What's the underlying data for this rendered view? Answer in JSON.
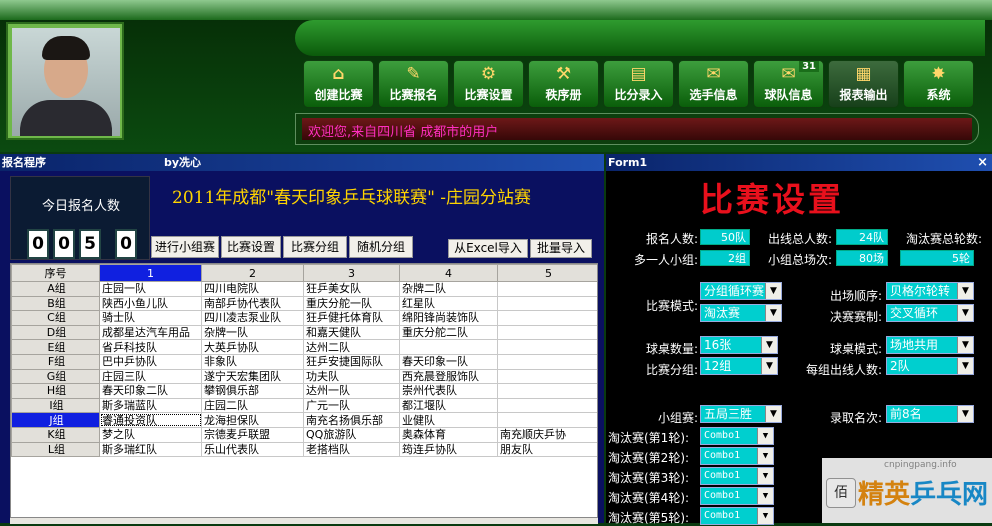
{
  "nav": {
    "buttons": [
      {
        "label": "创建比赛",
        "icon": "house-icon",
        "glyph": "⌂"
      },
      {
        "label": "比赛报名",
        "icon": "notebook-icon",
        "glyph": "✎"
      },
      {
        "label": "比赛设置",
        "icon": "tools-icon",
        "glyph": "⚙"
      },
      {
        "label": "秩序册",
        "icon": "gavel-icon",
        "glyph": "⚒"
      },
      {
        "label": "比分录入",
        "icon": "folder-icon",
        "glyph": "▤"
      },
      {
        "label": "选手信息",
        "icon": "scroll-icon",
        "glyph": "✉"
      },
      {
        "label": "球队信息",
        "icon": "envelope-icon",
        "glyph": "✉",
        "badge": "31"
      },
      {
        "label": "报表输出",
        "icon": "chest-icon",
        "glyph": "▦"
      },
      {
        "label": "系统",
        "icon": "gear-icon",
        "glyph": "✸"
      }
    ],
    "welcome": "欢迎您,来自四川省 成都市的用户"
  },
  "left_window": {
    "title": "报名程序",
    "author": "by冼心",
    "count_label": "今日报名人数",
    "count_digits": [
      "0",
      "5",
      "0"
    ],
    "event_title": "2011年成都\"春天印象乒乓球联赛\" -庄园分站赛",
    "tabs": [
      "进行小组赛",
      "比赛设置",
      "比赛分组",
      "随机分组"
    ],
    "right_tabs": [
      "从Excel导入",
      "批量导入"
    ],
    "grid": {
      "columns": [
        "序号",
        "1",
        "2",
        "3",
        "4",
        "5"
      ],
      "rows": [
        [
          "A组",
          "庄园一队",
          "四川电院队",
          "狂乒美女队",
          "杂牌二队",
          ""
        ],
        [
          "B组",
          "陕西小鱼儿队",
          "南部乒协代表队",
          "重庆分舵一队",
          "红星队",
          ""
        ],
        [
          "C组",
          "骑士队",
          "四川凌志泵业队",
          "狂乒健托体育队",
          "绵阳锋尚装饰队",
          ""
        ],
        [
          "D组",
          "成都星达汽车用品",
          "杂牌一队",
          "和嘉天健队",
          "重庆分舵二队",
          ""
        ],
        [
          "E组",
          "省乒科技队",
          "大英乒协队",
          "达州二队",
          "",
          " "
        ],
        [
          "F组",
          "巴中乒协队",
          "非象队",
          "狂乒安捷国际队",
          "春天印象一队",
          ""
        ],
        [
          "G组",
          "庄园三队",
          "遂宁天宏集团队",
          "功夫队",
          "西充晨登服饰队",
          ""
        ],
        [
          "H组",
          "春天印象二队",
          "攀钢俱乐部",
          "达州一队",
          "崇州代表队",
          ""
        ],
        [
          "I组",
          "斯多瑞蓝队",
          "庄园二队",
          "广元一队",
          "都江堰队",
          ""
        ],
        [
          "J组",
          "睿通投资队",
          "龙海担保队",
          "南充名扬俱乐部",
          "业健队",
          ""
        ],
        [
          "K组",
          "梦之队",
          "宗德麦乒联盟",
          "QQ旅游队",
          "奥森体育",
          "南充顺庆乒协"
        ],
        [
          "L组",
          "斯多瑞红队",
          "乐山代表队",
          "老搭档队",
          "筠连乒协队",
          "朋友队"
        ]
      ]
    }
  },
  "right_window": {
    "title": "Form1",
    "close": "×",
    "heading": "比赛设置",
    "stats": [
      {
        "label": "报名人数:",
        "value": "50队"
      },
      {
        "label": "出线总人数:",
        "value": "24队"
      },
      {
        "label": "淘汰赛总轮数:",
        "value": ""
      },
      {
        "label": "多一人小组:",
        "value": "2组"
      },
      {
        "label": "小组总场次:",
        "value": "80场"
      },
      {
        "label": "",
        "value": "5轮"
      }
    ],
    "fields": {
      "mode_label": "比赛模式:",
      "mode_1": "分组循环赛",
      "mode_2": "淘汰赛",
      "order_label": "出场顺序:",
      "order": "贝格尔轮转",
      "final_label": "决赛赛制:",
      "final": "交叉循环",
      "tables_label": "球桌数量:",
      "tables": "16张",
      "table_mode_label": "球桌模式:",
      "table_mode": "场地共用",
      "groups_label": "比赛分组:",
      "groups": "12组",
      "qualify_label": "每组出线人数:",
      "qualify": "2队",
      "group_stage_label": "小组赛:",
      "group_stage": "五局三胜",
      "admit_label": "录取名次:",
      "admit": "前8名"
    },
    "knockout": [
      {
        "label": "淘汰赛(第1轮):",
        "value": "Combo1"
      },
      {
        "label": "淘汰赛(第2轮):",
        "value": "Combo1"
      },
      {
        "label": "淘汰赛(第3轮):",
        "value": "Combo1"
      },
      {
        "label": "淘汰赛(第4轮):",
        "value": "Combo1"
      },
      {
        "label": "淘汰赛(第5轮):",
        "value": "Combo1"
      }
    ]
  },
  "watermark": {
    "url": "cnpingpang.info",
    "logo_a": "精英",
    "logo_b": "乒乓网",
    "btn": "佰"
  }
}
